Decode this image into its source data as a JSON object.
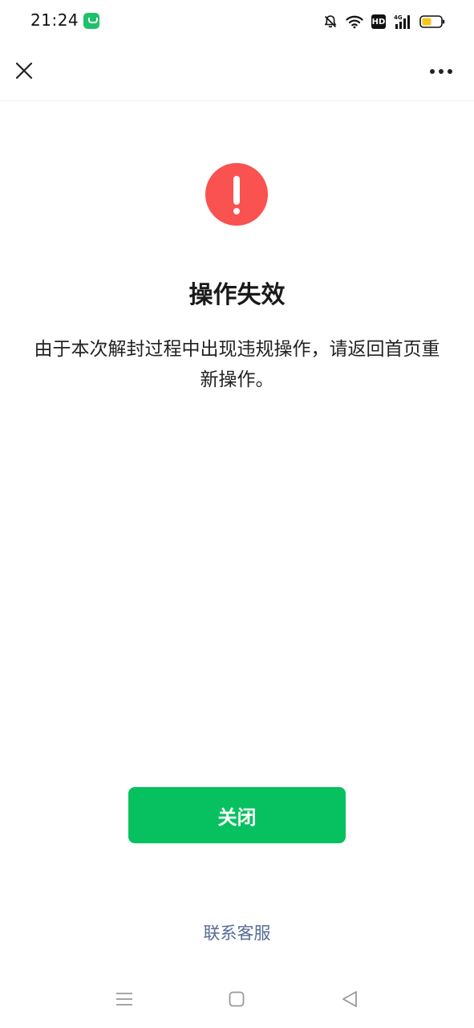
{
  "status_bar": {
    "time": "21:24",
    "hd_label": "HD",
    "network_label": "4G",
    "icons": [
      "app-notification-icon",
      "bell-muted-icon",
      "wifi-icon",
      "hd-icon",
      "cellular-signal-icon",
      "battery-icon"
    ]
  },
  "nav": {
    "close_icon": "close-icon",
    "more_icon": "more-icon"
  },
  "content": {
    "status_icon": "alert-icon",
    "title": "操作失效",
    "description": "由于本次解封过程中出现违规操作，请返回首页重新操作。"
  },
  "actions": {
    "close_label": "关闭",
    "contact_label": "联系客服"
  },
  "colors": {
    "accent_green": "#07c160",
    "alert_red": "#fa5151",
    "link_blue": "#576b95"
  },
  "system_nav": {
    "icons": [
      "menu-icon",
      "home-icon",
      "back-icon"
    ]
  }
}
